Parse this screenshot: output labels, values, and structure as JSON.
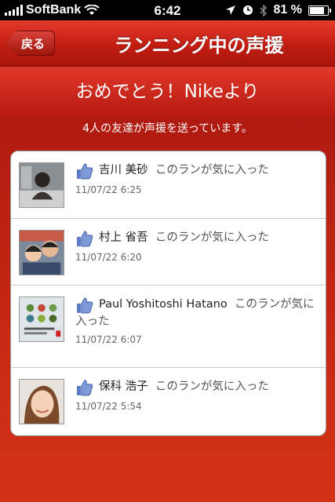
{
  "status_bar": {
    "carrier": "SoftBank",
    "time": "6:42",
    "battery": "81 %",
    "battery_level": 0.81
  },
  "nav": {
    "back_label": "戻る",
    "title": "ランニング中の声援"
  },
  "banner": "おめでとう！Nikeより",
  "subtitle": "4人の友達が声援を送っています。",
  "cheers": [
    {
      "name": "吉川 美砂",
      "action": "このランが気に入った",
      "timestamp": "11/07/22  6:25"
    },
    {
      "name": "村上 省吾",
      "action": "このランが気に入った",
      "timestamp": "11/07/22  6:20"
    },
    {
      "name": "Paul Yoshitoshi Hatano",
      "action": "このランが気に入った",
      "timestamp": "11/07/22  6:07"
    },
    {
      "name": "保科 浩子",
      "action": "このランが気に入った",
      "timestamp": "11/07/22  5:54"
    }
  ],
  "colors": {
    "nav_red": "#c11d12",
    "background_red": "#b3180e",
    "like_blue": "#5b7cc4"
  },
  "icons": [
    "signal-icon",
    "wifi-icon",
    "location-icon",
    "clock-icon",
    "bluetooth-icon",
    "battery-icon",
    "like-icon"
  ]
}
